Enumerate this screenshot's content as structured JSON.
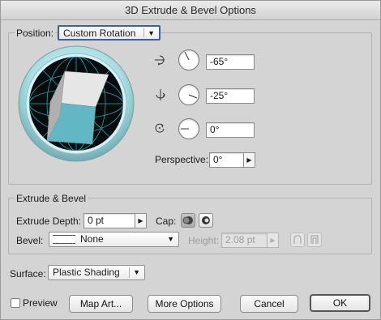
{
  "window": {
    "title": "3D Extrude & Bevel Options"
  },
  "position": {
    "label": "Position:",
    "value": "Custom Rotation",
    "rotations": [
      {
        "axis_icon": "x-axis-rotate-icon",
        "value": "-65°",
        "dial_angle_deg": -65
      },
      {
        "axis_icon": "y-axis-rotate-icon",
        "value": "-25°",
        "dial_angle_deg": -25
      },
      {
        "axis_icon": "z-axis-rotate-icon",
        "value": "0°",
        "dial_angle_deg": 0
      }
    ],
    "perspective_label": "Perspective:",
    "perspective_value": "0°"
  },
  "extrude": {
    "title": "Extrude & Bevel",
    "depth_label": "Extrude Depth:",
    "depth_value": "0 pt",
    "cap_label": "Cap:",
    "bevel_label": "Bevel:",
    "bevel_value": "None",
    "height_label": "Height:",
    "height_value": "2.08 pt"
  },
  "surface": {
    "label": "Surface:",
    "value": "Plastic Shading"
  },
  "footer": {
    "preview_label": "Preview",
    "map_art_label": "Map Art...",
    "more_options_label": "More Options",
    "cancel_label": "Cancel",
    "ok_label": "OK"
  },
  "colors": {
    "cube_front": "#b0b0b0",
    "cube_top": "#e6e6e6",
    "cube_side": "#63b6c3",
    "orb_ring": "#9fd9e0",
    "grid_line": "#2a9fb0"
  }
}
